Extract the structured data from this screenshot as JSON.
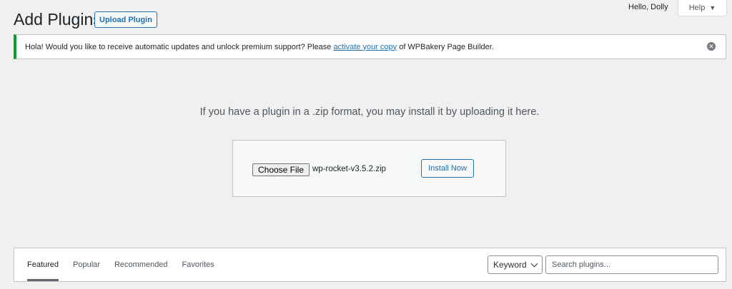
{
  "header": {
    "title": "Add Plugins",
    "upload_button": "Upload Plugin",
    "greeting": "Hello, Dolly",
    "help_label": "Help",
    "help_caret": "▼"
  },
  "notice": {
    "text_before": "Hola! Would you like to receive automatic updates and unlock premium support? Please ",
    "link_text": "activate your copy",
    "text_after": " of WPBakery Page Builder.",
    "dismiss_glyph": "✕",
    "accent_color": "#00a32a"
  },
  "upload": {
    "help_text": "If you have a plugin in a .zip format, you may install it by uploading it here.",
    "choose_file_label": "Choose File",
    "file_name": "wp-rocket-v3.5.2.zip",
    "install_button": "Install Now"
  },
  "filter": {
    "tabs": [
      {
        "label": "Featured",
        "active": true
      },
      {
        "label": "Popular",
        "active": false
      },
      {
        "label": "Recommended",
        "active": false
      },
      {
        "label": "Favorites",
        "active": false
      }
    ],
    "search_type": "Keyword",
    "search_placeholder": "Search plugins..."
  },
  "colors": {
    "link": "#2271b1",
    "background": "#f0f0f1"
  }
}
